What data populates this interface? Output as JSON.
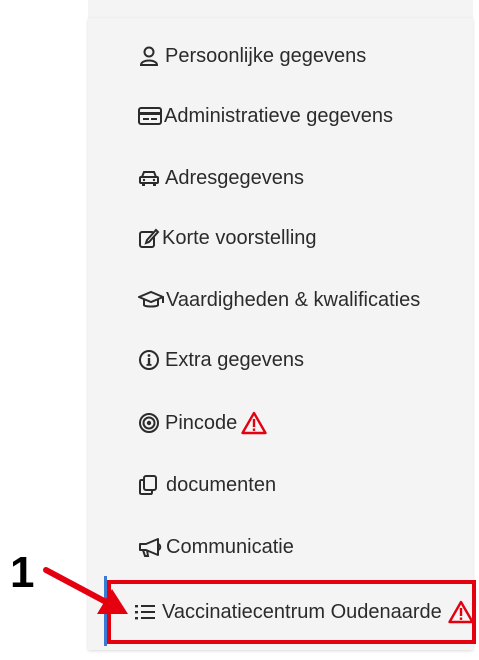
{
  "menu": {
    "items": [
      {
        "label": "Persoonlijke gegevens",
        "icon": "user-icon"
      },
      {
        "label": "Administratieve gegevens",
        "icon": "id-card-icon"
      },
      {
        "label": "Adresgegevens",
        "icon": "car-icon"
      },
      {
        "label": "Korte voorstelling",
        "icon": "edit-icon"
      },
      {
        "label": "Vaardigheden & kwalificaties",
        "icon": "graduation-cap-icon"
      },
      {
        "label": "Extra gegevens",
        "icon": "info-icon"
      },
      {
        "label": "Pincode",
        "icon": "target-icon",
        "warning": true
      },
      {
        "label": "documenten",
        "icon": "copy-icon"
      },
      {
        "label": "Communicatie",
        "icon": "megaphone-icon"
      },
      {
        "label": "Vaccinatiecentrum Oudenaarde",
        "icon": "list-icon",
        "warning": true,
        "highlighted": true
      }
    ]
  },
  "annotation": {
    "number": "1"
  },
  "colors": {
    "warning": "#e4000f",
    "highlight": "#e4000f",
    "text": "#2b2b2b",
    "panel": "#f4f4f4"
  }
}
